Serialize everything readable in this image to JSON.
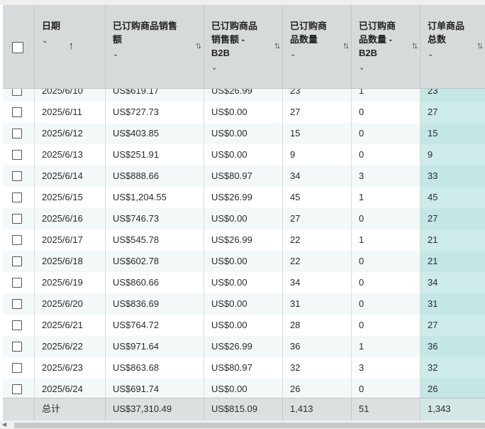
{
  "columns": [
    {
      "label": "",
      "sort": ""
    },
    {
      "label": "日期",
      "sort": "↑"
    },
    {
      "label": "已订购商品销售额",
      "sort": "↑↓"
    },
    {
      "label": "已订购商品销售额 - B2B",
      "sort": "↑↓"
    },
    {
      "label": "已订购商品数量",
      "sort": "↑↓"
    },
    {
      "label": "已订购商品数量 - B2B",
      "sort": "↑↓"
    },
    {
      "label": "订单商品总数",
      "sort": "↑↓"
    }
  ],
  "header_lines": [
    [],
    [
      "日期"
    ],
    [
      "已订购商品销售",
      "额"
    ],
    [
      "已订购商品",
      "销售额 -",
      "B2B"
    ],
    [
      "已订购商",
      "品数量"
    ],
    [
      "已订购商",
      "品数量 -",
      "B2B"
    ],
    [
      "订单商品",
      "总数"
    ]
  ],
  "partial_row": [
    "2025/6/10",
    "US$619.17",
    "US$26.99",
    "23",
    "1",
    "23"
  ],
  "rows": [
    [
      "2025/6/11",
      "US$727.73",
      "US$0.00",
      "27",
      "0",
      "27"
    ],
    [
      "2025/6/12",
      "US$403.85",
      "US$0.00",
      "15",
      "0",
      "15"
    ],
    [
      "2025/6/13",
      "US$251.91",
      "US$0.00",
      "9",
      "0",
      "9"
    ],
    [
      "2025/6/14",
      "US$888.66",
      "US$80.97",
      "34",
      "3",
      "33"
    ],
    [
      "2025/6/15",
      "US$1,204.55",
      "US$26.99",
      "45",
      "1",
      "45"
    ],
    [
      "2025/6/16",
      "US$746.73",
      "US$0.00",
      "27",
      "0",
      "27"
    ],
    [
      "2025/6/17",
      "US$545.78",
      "US$26.99",
      "22",
      "1",
      "21"
    ],
    [
      "2025/6/18",
      "US$602.78",
      "US$0.00",
      "22",
      "0",
      "21"
    ],
    [
      "2025/6/19",
      "US$860.66",
      "US$0.00",
      "34",
      "0",
      "34"
    ],
    [
      "2025/6/20",
      "US$836.69",
      "US$0.00",
      "31",
      "0",
      "31"
    ],
    [
      "2025/6/21",
      "US$764.72",
      "US$0.00",
      "28",
      "0",
      "27"
    ],
    [
      "2025/6/22",
      "US$971.64",
      "US$26.99",
      "36",
      "1",
      "36"
    ],
    [
      "2025/6/23",
      "US$863.68",
      "US$80.97",
      "32",
      "3",
      "32"
    ],
    [
      "2025/6/24",
      "US$691.74",
      "US$0.00",
      "26",
      "0",
      "26"
    ]
  ],
  "totals": [
    "总计",
    "US$37,310.49",
    "US$815.09",
    "1,413",
    "51",
    "1,343"
  ],
  "colors": {
    "header_bg": "#d6dadb",
    "highlight_col": "#cdebea",
    "row_alt": "#f3f8f8"
  }
}
